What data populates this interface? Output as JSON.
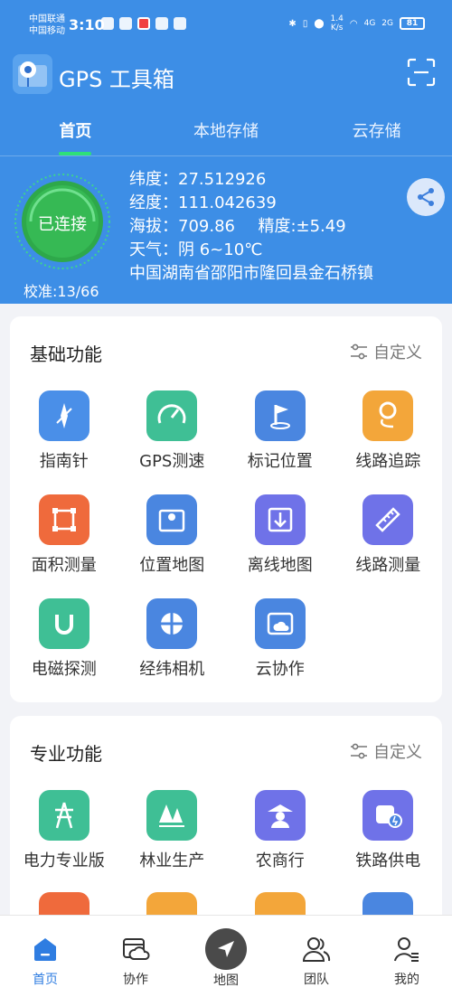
{
  "status_bar": {
    "carrier1": "中国联通",
    "carrier2": "中国移动",
    "time": "3:10",
    "speed": "1.4",
    "speed_unit": "K/s",
    "net1": "4G",
    "net2": "2G",
    "battery": "81"
  },
  "app": {
    "title": "GPS 工具箱"
  },
  "tabs": [
    {
      "label": "首页",
      "active": true
    },
    {
      "label": "本地存储",
      "active": false
    },
    {
      "label": "云存储",
      "active": false
    }
  ],
  "status": {
    "connection": "已连接",
    "calibration": "校准:13/66",
    "latitude": "纬度：27.512926",
    "longitude": "经度：111.042639",
    "altitude": "海拔：709.86",
    "accuracy": "精度:±5.49",
    "weather": "天气：阴 6~10℃",
    "address": "中国湖南省邵阳市隆回县金石桥镇"
  },
  "basic": {
    "title": "基础功能",
    "customize": "自定义",
    "items": [
      {
        "label": "指南针",
        "icon": "compass-icon",
        "color": "#4a8fe8"
      },
      {
        "label": "GPS测速",
        "icon": "speedometer-icon",
        "color": "#3fbf95"
      },
      {
        "label": "标记位置",
        "icon": "flag-pin-icon",
        "color": "#4a86e0"
      },
      {
        "label": "线路追踪",
        "icon": "route-track-icon",
        "color": "#f3a63a"
      },
      {
        "label": "面积测量",
        "icon": "area-measure-icon",
        "color": "#ef6a3c"
      },
      {
        "label": "位置地图",
        "icon": "location-map-icon",
        "color": "#4a86e0"
      },
      {
        "label": "离线地图",
        "icon": "offline-map-icon",
        "color": "#6f72e8"
      },
      {
        "label": "线路测量",
        "icon": "ruler-icon",
        "color": "#6f72e8"
      },
      {
        "label": "电磁探测",
        "icon": "magnet-icon",
        "color": "#3fbf95"
      },
      {
        "label": "经纬相机",
        "icon": "camera-icon",
        "color": "#4a86e0"
      },
      {
        "label": "云协作",
        "icon": "cloud-folder-icon",
        "color": "#4a86e0"
      }
    ]
  },
  "professional": {
    "title": "专业功能",
    "customize": "自定义",
    "items": [
      {
        "label": "电力专业版",
        "icon": "power-tower-icon",
        "color": "#3fbf95"
      },
      {
        "label": "林业生产",
        "icon": "forest-icon",
        "color": "#3fbf95"
      },
      {
        "label": "农商行",
        "icon": "farmer-icon",
        "color": "#6f72e8"
      },
      {
        "label": "铁路供电",
        "icon": "train-power-icon",
        "color": "#6f72e8"
      }
    ],
    "partial_colors": [
      "#ef6a3c",
      "#f3a63a",
      "#f3a63a",
      "#4a86e0"
    ]
  },
  "nav": [
    {
      "label": "首页",
      "icon": "home-icon",
      "active": true
    },
    {
      "label": "协作",
      "icon": "cloud-collab-icon",
      "active": false
    },
    {
      "label": "地图",
      "icon": "navigation-arrow-icon",
      "active": false
    },
    {
      "label": "团队",
      "icon": "team-icon",
      "active": false
    },
    {
      "label": "我的",
      "icon": "user-icon",
      "active": false
    }
  ]
}
